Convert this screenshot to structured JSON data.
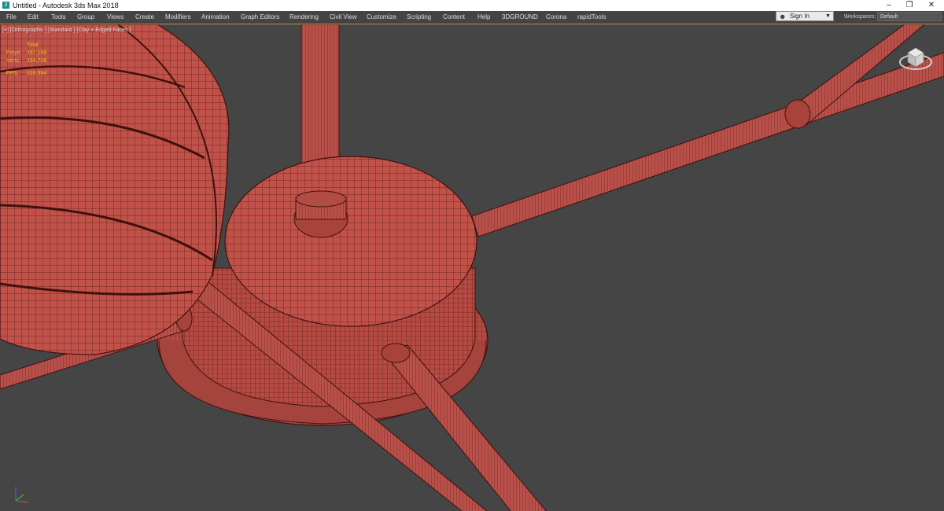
{
  "window": {
    "title": "Untitled - Autodesk 3ds Max 2018",
    "app_icon": "3",
    "controls": {
      "minimize": "–",
      "restore": "❐",
      "close": "✕"
    }
  },
  "menu": [
    "File",
    "Edit",
    "Tools",
    "Group",
    "Views",
    "Create",
    "Modifiers",
    "Animation",
    "Graph Editors",
    "Rendering",
    "Civil View",
    "Customize",
    "Scripting",
    "Content",
    "Help",
    "3DGROUND",
    "Corona",
    "rapidTools"
  ],
  "account": {
    "sign_in_label": "Sign In"
  },
  "workspace": {
    "label": "Workspaces:",
    "value": "Default"
  },
  "viewport": {
    "label": "[+] [Orthographic ] [Standard ] [Clay + Edged Faces ]",
    "stats": {
      "total_label": "Total",
      "rows": [
        {
          "key": "Polys:",
          "value": "167,168"
        },
        {
          "key": "Verts:",
          "value": "154,708"
        },
        {
          "key": "FPS:",
          "value": "316.994"
        }
      ]
    }
  },
  "colors": {
    "viewport_bg": "#454545",
    "mesh_clay": "#c0524a",
    "wire_edge": "#5a1a16",
    "stats_text": "#e8c21a",
    "active_border": "#c8a44a"
  }
}
